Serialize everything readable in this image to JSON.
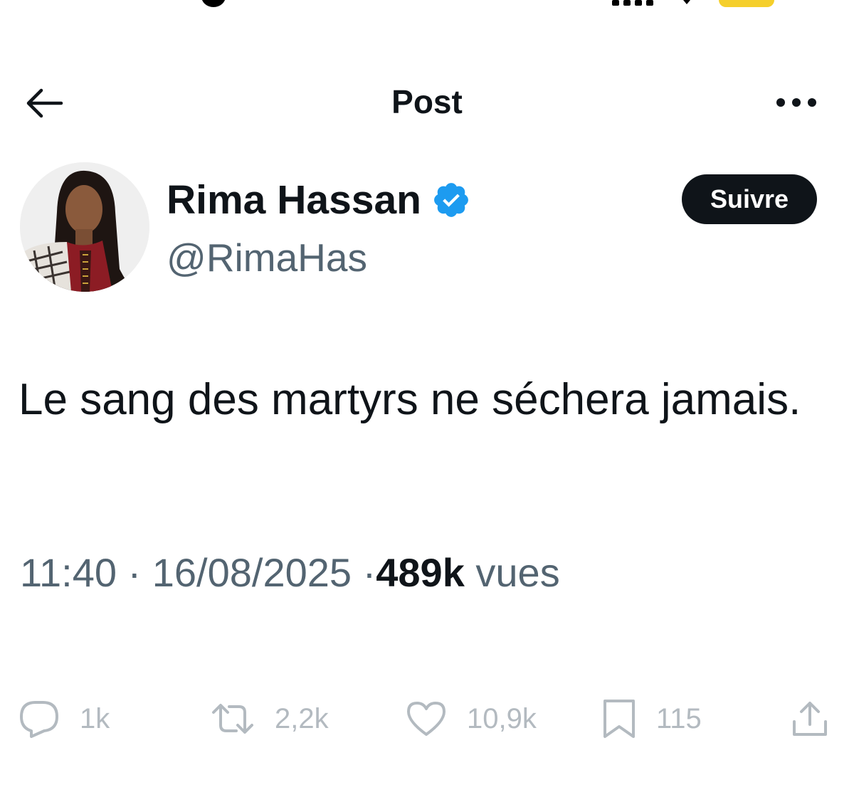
{
  "status_bar": {
    "battery_color": "#f5cf2b"
  },
  "header": {
    "title": "Post",
    "back_icon": "arrow-left-icon",
    "more_icon": "more-horizontal-icon"
  },
  "author": {
    "name": "Rima Hassan",
    "handle": "@RimaHas",
    "verified": true,
    "verified_color": "#1d9bf0",
    "follow_label": "Suivre"
  },
  "tweet": {
    "text": "Le sang des martyrs ne séchera jamais.",
    "time": "11:40",
    "date": "16/08/2025",
    "separator": "·",
    "views_count": "489k",
    "views_label": "vues"
  },
  "actions": {
    "reply": {
      "icon": "reply-icon",
      "count": "1k"
    },
    "repost": {
      "icon": "repost-icon",
      "count": "2,2k"
    },
    "like": {
      "icon": "heart-icon",
      "count": "10,9k"
    },
    "bookmark": {
      "icon": "bookmark-icon",
      "count": "115"
    },
    "share": {
      "icon": "share-icon"
    }
  },
  "colors": {
    "text_primary": "#0f1419",
    "text_secondary": "#536471",
    "action_gray": "#b3bac0",
    "follow_bg": "#0f1419"
  }
}
